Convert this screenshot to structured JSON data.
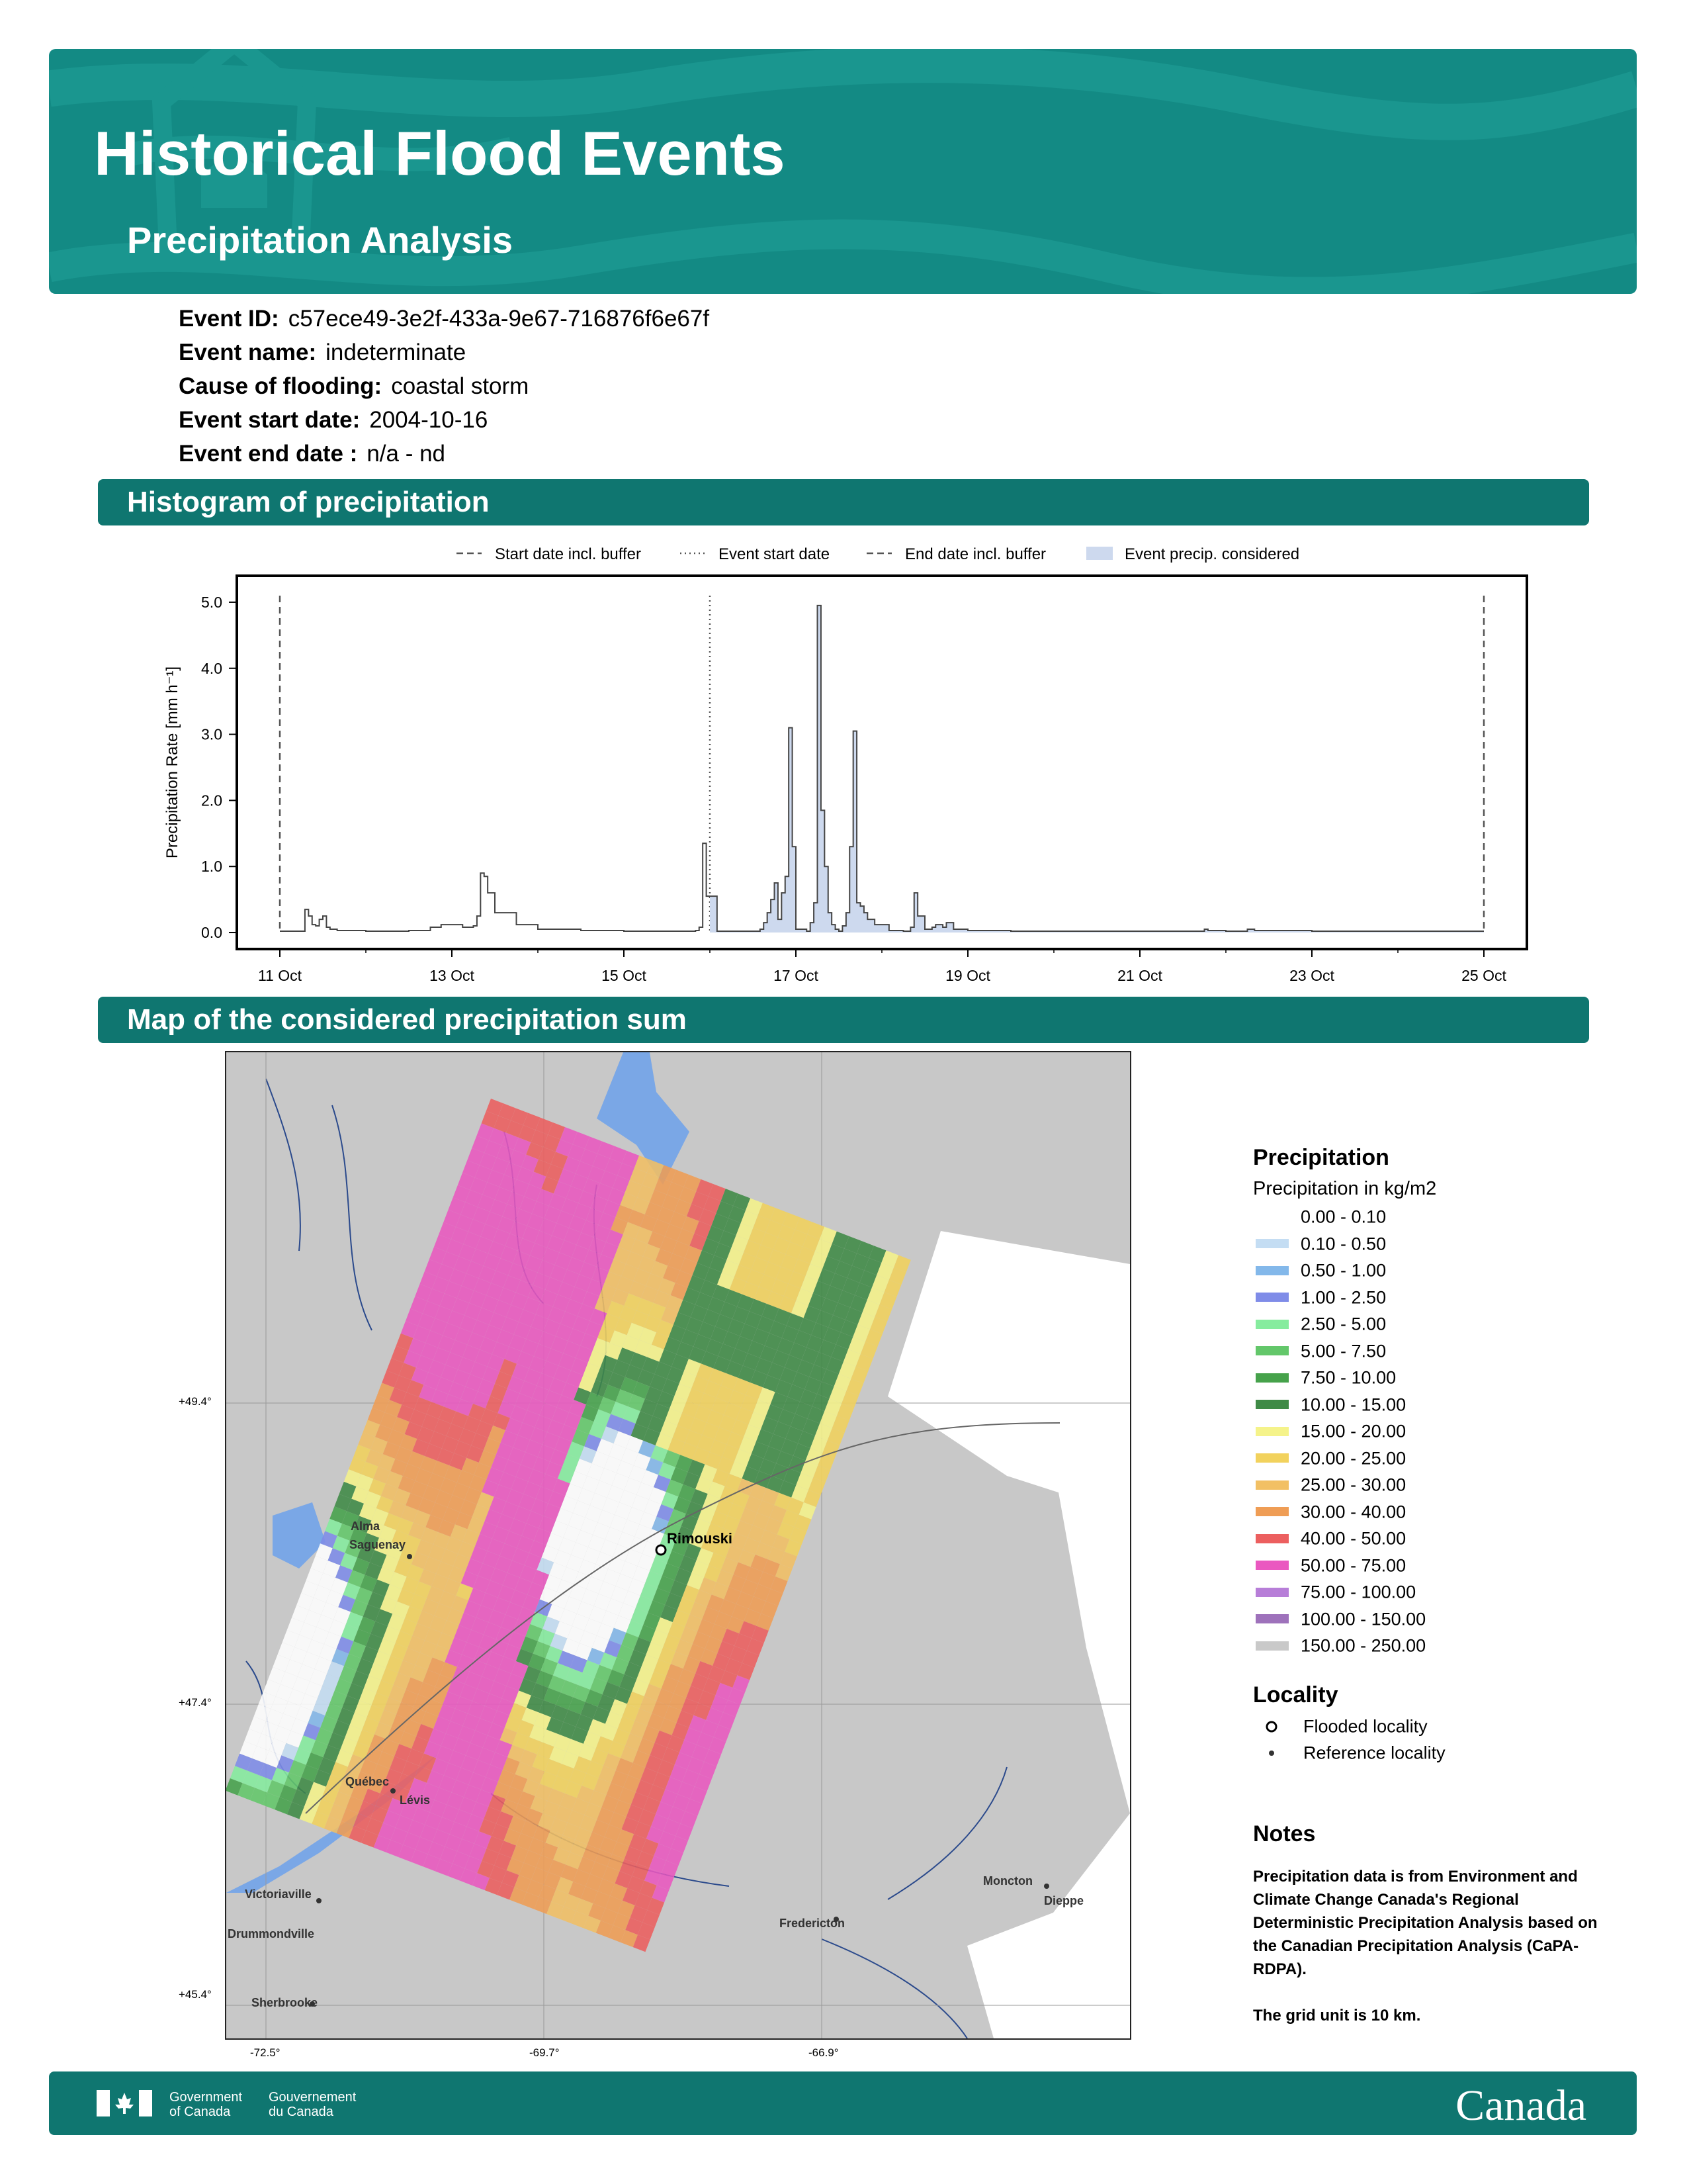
{
  "header": {
    "title": "Historical Flood Events",
    "subtitle": "Precipitation Analysis"
  },
  "event": {
    "id_label": "Event ID:",
    "id_value": "c57ece49-3e2f-433a-9e67-716876f6e67f",
    "name_label": "Event name:",
    "name_value": "indeterminate",
    "cause_label": "Cause of flooding:",
    "cause_value": "coastal storm",
    "start_label": "Event start date:",
    "start_value": "2004-10-16",
    "end_label": "Event end date :",
    "end_value": "n/a - nd"
  },
  "sections": {
    "histogram": "Histogram of precipitation",
    "map": "Map of the considered precipitation sum"
  },
  "chart_data": {
    "type": "area",
    "ylabel": "Precipitation Rate [mm h⁻¹]",
    "ylim": [
      -0.25,
      5.4
    ],
    "xlim": [
      "2004-10-10 12:00",
      "2004-10-25 12:00"
    ],
    "yticks": [
      "0.0",
      "1.0",
      "2.0",
      "3.0",
      "4.0",
      "5.0"
    ],
    "xticks": [
      "11 Oct",
      "13 Oct",
      "15 Oct",
      "17 Oct",
      "19 Oct",
      "21 Oct",
      "23 Oct",
      "25 Oct"
    ],
    "legend": {
      "placement": "top",
      "entries": [
        "Start date incl. buffer",
        "Event start date",
        "End date incl. buffer",
        "Event precip. considered"
      ]
    },
    "markers": {
      "start_buffer": "2004-10-11 00:00",
      "event_start": "2004-10-16 00:00",
      "end_buffer": "2004-10-25 00:00"
    },
    "x": [
      "2004-10-11 00:00",
      "2004-10-11 06:00",
      "2004-10-11 07:00",
      "2004-10-11 08:00",
      "2004-10-11 09:00",
      "2004-10-11 10:00",
      "2004-10-11 11:00",
      "2004-10-11 12:00",
      "2004-10-11 13:00",
      "2004-10-11 14:00",
      "2004-10-11 16:00",
      "2004-10-12 00:00",
      "2004-10-12 12:00",
      "2004-10-12 18:00",
      "2004-10-12 21:00",
      "2004-10-13 00:00",
      "2004-10-13 03:00",
      "2004-10-13 06:00",
      "2004-10-13 07:00",
      "2004-10-13 08:00",
      "2004-10-13 09:00",
      "2004-10-13 10:00",
      "2004-10-13 12:00",
      "2004-10-13 18:00",
      "2004-10-14 00:00",
      "2004-10-14 12:00",
      "2004-10-15 00:00",
      "2004-10-15 12:00",
      "2004-10-15 20:00",
      "2004-10-15 21:00",
      "2004-10-15 22:00",
      "2004-10-15 23:00",
      "2004-10-16 02:00",
      "2004-10-16 12:00",
      "2004-10-16 14:00",
      "2004-10-16 15:00",
      "2004-10-16 16:00",
      "2004-10-16 17:00",
      "2004-10-16 18:00",
      "2004-10-16 19:00",
      "2004-10-16 20:00",
      "2004-10-16 21:00",
      "2004-10-16 22:00",
      "2004-10-16 23:00",
      "2004-10-17 00:00",
      "2004-10-17 03:00",
      "2004-10-17 04:00",
      "2004-10-17 05:00",
      "2004-10-17 06:00",
      "2004-10-17 07:00",
      "2004-10-17 08:00",
      "2004-10-17 09:00",
      "2004-10-17 10:00",
      "2004-10-17 11:00",
      "2004-10-17 12:00",
      "2004-10-17 13:00",
      "2004-10-17 14:00",
      "2004-10-17 15:00",
      "2004-10-17 16:00",
      "2004-10-17 17:00",
      "2004-10-17 18:00",
      "2004-10-17 19:00",
      "2004-10-17 20:00",
      "2004-10-17 22:00",
      "2004-10-18 02:00",
      "2004-10-18 06:00",
      "2004-10-18 08:00",
      "2004-10-18 09:00",
      "2004-10-18 10:00",
      "2004-10-18 12:00",
      "2004-10-18 14:00",
      "2004-10-18 15:00",
      "2004-10-18 17:00",
      "2004-10-18 18:00",
      "2004-10-18 20:00",
      "2004-10-19 00:00",
      "2004-10-19 12:00",
      "2004-10-20 00:00",
      "2004-10-21 00:00",
      "2004-10-21 18:00",
      "2004-10-21 19:00",
      "2004-10-22 00:00",
      "2004-10-22 06:00",
      "2004-10-22 08:00",
      "2004-10-23 00:00",
      "2004-10-24 00:00",
      "2004-10-25 00:00"
    ],
    "series": [
      {
        "values": [
          0.02,
          0.02,
          0.35,
          0.25,
          0.12,
          0.1,
          0.2,
          0.25,
          0.08,
          0.05,
          0.03,
          0.02,
          0.03,
          0.08,
          0.12,
          0.12,
          0.08,
          0.1,
          0.25,
          0.9,
          0.85,
          0.6,
          0.3,
          0.12,
          0.05,
          0.03,
          0.02,
          0.02,
          0.03,
          0.08,
          1.35,
          0.55,
          0.02,
          0.02,
          0.05,
          0.15,
          0.3,
          0.5,
          0.75,
          0.2,
          0.6,
          0.85,
          3.1,
          1.3,
          0.05,
          0.02,
          0.15,
          0.45,
          4.95,
          1.85,
          1.0,
          0.3,
          0.12,
          0.05,
          0.02,
          0.1,
          0.3,
          1.3,
          3.05,
          0.45,
          0.4,
          0.3,
          0.2,
          0.12,
          0.03,
          0.02,
          0.08,
          0.6,
          0.25,
          0.05,
          0.08,
          0.12,
          0.08,
          0.15,
          0.05,
          0.03,
          0.02,
          0.02,
          0.02,
          0.05,
          0.03,
          0.02,
          0.05,
          0.03,
          0.02,
          0.02,
          0.02
        ]
      }
    ]
  },
  "map": {
    "x_ticks": [
      "-72.5°",
      "-69.7°",
      "-66.9°"
    ],
    "y_ticks": [
      "+49.4°",
      "+47.4°",
      "+45.4°"
    ],
    "flooded_localities": [
      "Rimouski"
    ],
    "reference_localities": [
      "Alma",
      "Saguenay",
      "Québec",
      "Lévis",
      "Victoriaville",
      "Drummondville",
      "Sherbrooke",
      "Fredericton",
      "Moncton",
      "Dieppe"
    ]
  },
  "legend": {
    "precip_title": "Precipitation",
    "precip_subtitle": "Precipitation in kg/m2",
    "classes": [
      {
        "label": "0.00 - 0.10",
        "color": "#ffffff"
      },
      {
        "label": "0.10 - 0.50",
        "color": "#c4ddf3"
      },
      {
        "label": "0.50 - 1.00",
        "color": "#83b8ea"
      },
      {
        "label": "1.00 - 2.50",
        "color": "#7f8ce8"
      },
      {
        "label": "2.50 - 5.00",
        "color": "#86ec9e"
      },
      {
        "label": "5.00 - 7.50",
        "color": "#63c76a"
      },
      {
        "label": "7.50 - 10.00",
        "color": "#46a24b"
      },
      {
        "label": "10.00 - 15.00",
        "color": "#3f8a46"
      },
      {
        "label": "15.00 - 20.00",
        "color": "#f5f38a"
      },
      {
        "label": "20.00 - 25.00",
        "color": "#f2d25d"
      },
      {
        "label": "25.00 - 30.00",
        "color": "#f2c064"
      },
      {
        "label": "30.00 - 40.00",
        "color": "#ef9d55"
      },
      {
        "label": "40.00 - 50.00",
        "color": "#ec5f5f"
      },
      {
        "label": "50.00 - 75.00",
        "color": "#ea58c0"
      },
      {
        "label": "75.00 - 100.00",
        "color": "#b77ed8"
      },
      {
        "label": "100.00 - 150.00",
        "color": "#9e72bb"
      },
      {
        "label": "150.00 - 250.00",
        "color": "#c9c9c9"
      }
    ],
    "locality_title": "Locality",
    "flooded_label": "Flooded locality",
    "reference_label": "Reference locality",
    "notes_title": "Notes",
    "notes_p1": "Precipitation data is from Environment and Climate Change Canada's Regional Deterministic Precipitation Analysis based on the Canadian Precipitation Analysis (CaPA-RDPA).",
    "notes_p2": "The grid unit is 10 km."
  },
  "footer": {
    "gov_en_1": "Government",
    "gov_en_2": "of Canada",
    "gov_fr_1": "Gouvernement",
    "gov_fr_2": "du Canada",
    "wordmark": "Canada"
  },
  "colors": {
    "banner": "#138a84",
    "section_bar": "#0f7670",
    "footer": "#0f7670",
    "precip_fill": "#cdd9ee"
  }
}
